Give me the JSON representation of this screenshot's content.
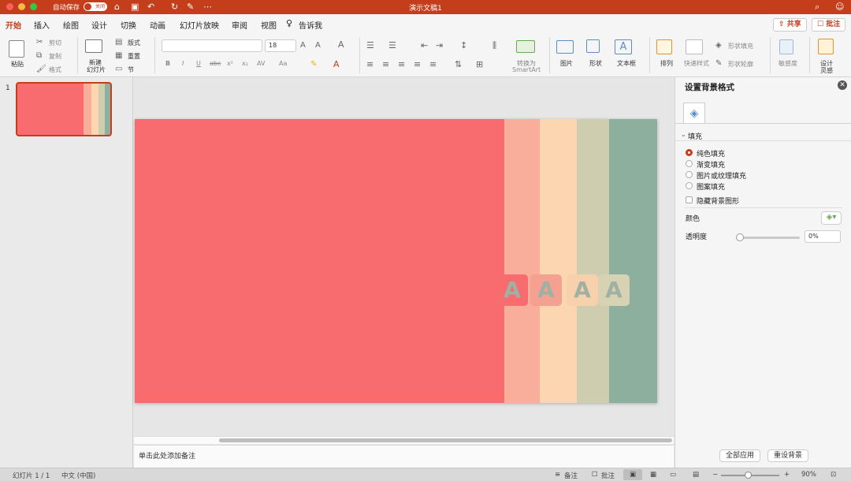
{
  "window": {
    "title": "演示文稿1",
    "autosave_label": "自动保存",
    "autosave_state": "关闭"
  },
  "tabs": [
    {
      "label": "开始",
      "active": true
    },
    {
      "label": "插入"
    },
    {
      "label": "绘图"
    },
    {
      "label": "设计"
    },
    {
      "label": "切换"
    },
    {
      "label": "动画"
    },
    {
      "label": "幻灯片放映"
    },
    {
      "label": "审阅"
    },
    {
      "label": "视图"
    }
  ],
  "tell_me": "告诉我",
  "header": {
    "share": "共享",
    "comments": "批注"
  },
  "ribbon": {
    "paste": "粘贴",
    "cut": "剪切",
    "copy": "复制",
    "format": "格式",
    "new_slide_1": "新建",
    "new_slide_2": "幻灯片",
    "layout": "版式",
    "reset": "重置",
    "section": "节",
    "font_size": "18",
    "bold": "B",
    "italic": "I",
    "underline": "U",
    "strike": "abc",
    "sup": "x²",
    "sub": "x₂",
    "spacing": "AV",
    "case": "Aa",
    "convert_1": "转换为",
    "convert_2": "SmartArt",
    "picture": "图片",
    "shapes": "形状",
    "textbox": "文本框",
    "arrange": "排列",
    "quick_styles": "快速样式",
    "shape_fill": "形状填充",
    "shape_outline": "形状轮廓",
    "sensitivity": "敏感度",
    "designer_1": "设计",
    "designer_2": "灵感"
  },
  "thumbnails": [
    {
      "number": "1"
    }
  ],
  "slide": {
    "background": "#f86b6e",
    "strips": [
      "#f9ae9c",
      "#fbd6b1",
      "#cfcdb0",
      "#8daf9d"
    ],
    "tiles": [
      {
        "letter": "A",
        "bg": "#f86b6e",
        "fg": "#a0b0a2"
      },
      {
        "letter": "A",
        "bg": "#f5a191",
        "fg": "#a0b0a2"
      },
      {
        "letter": "A",
        "bg": "#f7d1ac",
        "fg": "#a0b0a2"
      },
      {
        "letter": "A",
        "bg": "#d7d2b4",
        "fg": "#a0b0a2"
      }
    ]
  },
  "notes": {
    "placeholder": "单击此处添加备注"
  },
  "format_pane": {
    "title": "设置背景格式",
    "section": "填充",
    "options": [
      {
        "label": "纯色填充",
        "selected": true
      },
      {
        "label": "渐变填充"
      },
      {
        "label": "图片或纹理填充"
      },
      {
        "label": "图案填充"
      }
    ],
    "hide_bg": "隐藏背景图形",
    "color_label": "颜色",
    "transparency_label": "透明度",
    "transparency_value": "0%",
    "apply_all": "全部应用",
    "reset_bg": "重设背景"
  },
  "status": {
    "slide_count": "幻灯片 1 / 1",
    "language": "中文 (中国)",
    "notes": "备注",
    "comments": "批注",
    "zoom": "90%"
  },
  "colors": {
    "accent": "#c43e1c"
  }
}
